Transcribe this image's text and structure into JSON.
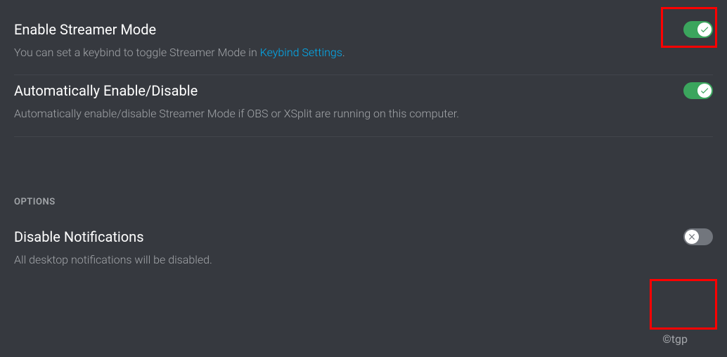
{
  "settings": {
    "enable_streamer": {
      "title": "Enable Streamer Mode",
      "desc_prefix": "You can set a keybind to toggle Streamer Mode in ",
      "desc_link": "Keybind Settings",
      "desc_suffix": ".",
      "on": true
    },
    "auto_enable": {
      "title": "Automatically Enable/Disable",
      "desc": "Automatically enable/disable Streamer Mode if OBS or XSplit are running on this computer.",
      "on": true
    },
    "disable_notifications": {
      "title": "Disable Notifications",
      "desc": "All desktop notifications will be disabled.",
      "on": false
    }
  },
  "section_title": "OPTIONS",
  "watermark": "©tgp",
  "colors": {
    "toggle_on": "#3ba55d",
    "toggle_off": "#72767d",
    "link": "#00aff4",
    "highlight": "#ff0000",
    "bg": "#36393f"
  }
}
